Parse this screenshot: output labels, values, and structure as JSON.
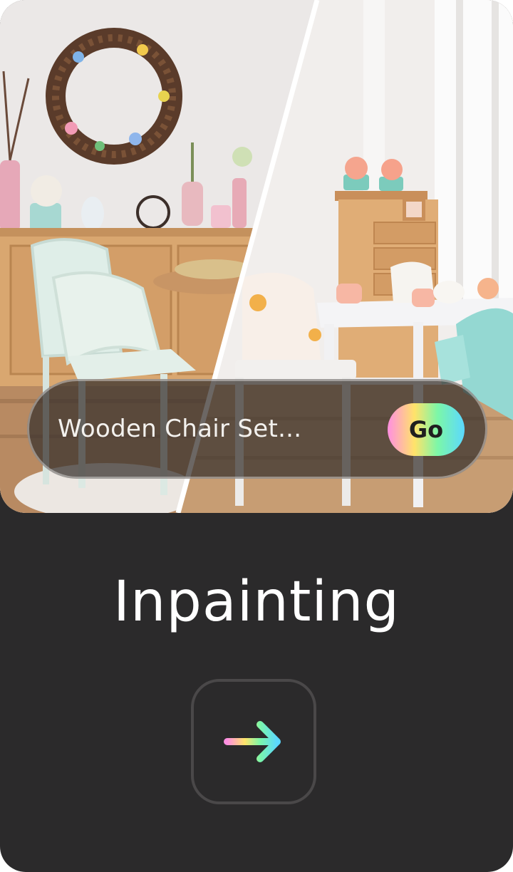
{
  "card": {
    "prompt": {
      "text": "Wooden Chair Set..."
    },
    "go_button": {
      "label": "Go"
    },
    "title": "Inpainting",
    "next_button": {
      "icon": "arrow-right-icon"
    }
  },
  "colors": {
    "card_bg": "#2b2a2b",
    "title": "#ffffff",
    "gradient": [
      "#ff8fe1",
      "#ffe36a",
      "#7cf7a8",
      "#5bd8ff"
    ]
  }
}
